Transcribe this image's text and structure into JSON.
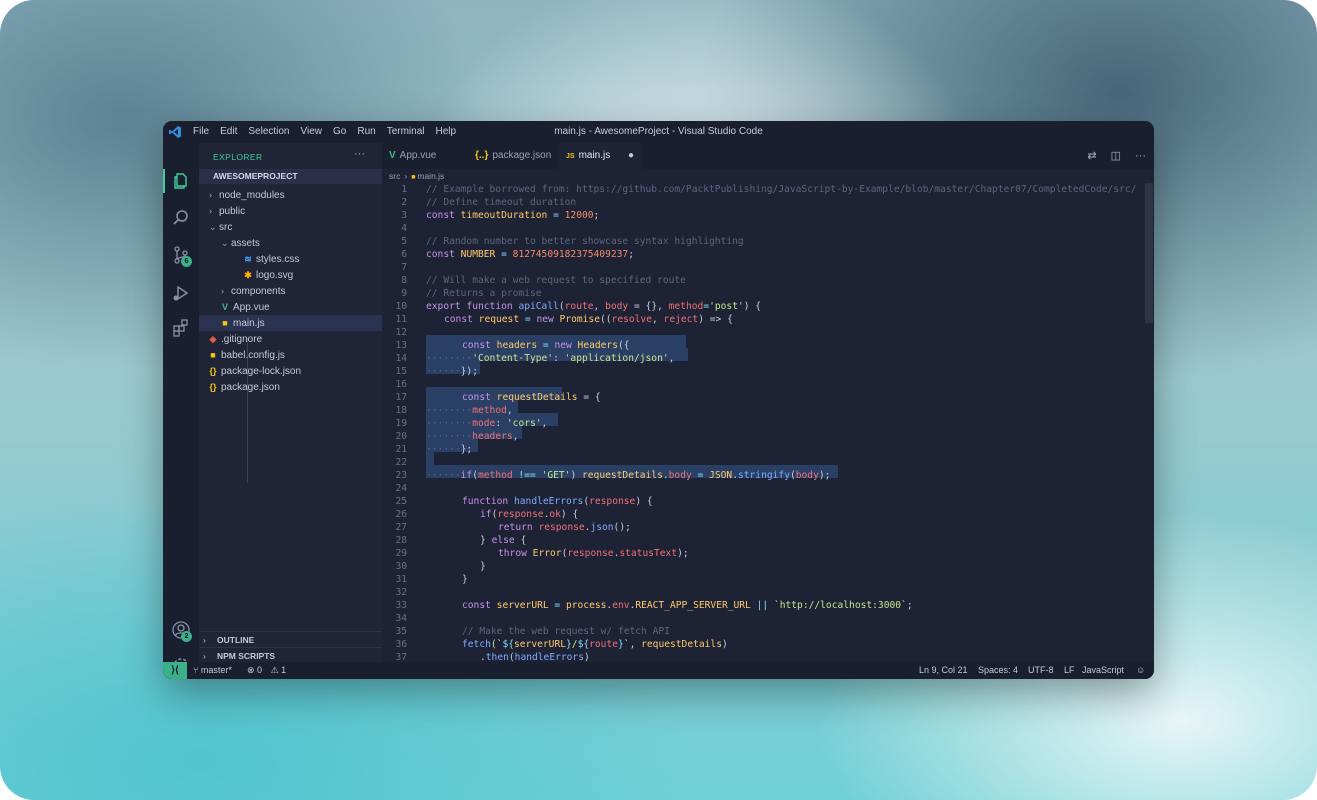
{
  "window": {
    "title": "main.js - AwesomeProject - Visual Studio Code",
    "menu": [
      "File",
      "Edit",
      "Selection",
      "View",
      "Go",
      "Run",
      "Terminal",
      "Help"
    ]
  },
  "activity": {
    "scm_badge": "6",
    "accounts_badge": "2"
  },
  "sidebar": {
    "header": "EXPLORER",
    "more": "···",
    "project": "AWESOMEPROJECT",
    "items": [
      {
        "label": "node_modules",
        "icon": "chevron-right"
      },
      {
        "label": "public",
        "icon": "chevron-right"
      },
      {
        "label": "src",
        "icon": "chevron-down"
      },
      {
        "label": "assets",
        "icon": "chevron-down"
      },
      {
        "label": "styles.css",
        "icon": "css-file-icon"
      },
      {
        "label": "logo.svg",
        "icon": "svg-file-icon"
      },
      {
        "label": "components",
        "icon": "chevron-right"
      },
      {
        "label": "App.vue",
        "icon": "vue-file-icon"
      },
      {
        "label": "main.js",
        "icon": "js-file-icon"
      },
      {
        "label": ".gitignore",
        "icon": "git-file-icon"
      },
      {
        "label": "babel.config.js",
        "icon": "js-file-icon"
      },
      {
        "label": "package-lock.json",
        "icon": "json-file-icon"
      },
      {
        "label": "package.json",
        "icon": "json-file-icon"
      }
    ],
    "outline": "OUTLINE",
    "npm_scripts": "NPM SCRIPTS"
  },
  "tabs": [
    {
      "label": "App.vue",
      "icon": "V"
    },
    {
      "label": "package.json",
      "icon": "{..}"
    },
    {
      "label": "main.js",
      "icon": "JS",
      "modified": "●"
    }
  ],
  "breadcrumb": [
    "src",
    "main.js"
  ],
  "code": {
    "lines": [
      {
        "n": "1"
      },
      {
        "n": "2"
      },
      {
        "n": "3"
      },
      {
        "n": "4"
      },
      {
        "n": "5"
      },
      {
        "n": "6"
      },
      {
        "n": "7"
      },
      {
        "n": "8"
      },
      {
        "n": "9"
      },
      {
        "n": "10"
      },
      {
        "n": "11"
      },
      {
        "n": "12"
      },
      {
        "n": "13"
      },
      {
        "n": "14"
      },
      {
        "n": "15"
      },
      {
        "n": "16"
      },
      {
        "n": "17"
      },
      {
        "n": "18"
      },
      {
        "n": "19"
      },
      {
        "n": "20"
      },
      {
        "n": "21"
      },
      {
        "n": "22"
      },
      {
        "n": "23"
      },
      {
        "n": "24"
      },
      {
        "n": "25"
      },
      {
        "n": "26"
      },
      {
        "n": "27"
      },
      {
        "n": "28"
      },
      {
        "n": "29"
      },
      {
        "n": "30"
      },
      {
        "n": "31"
      },
      {
        "n": "32"
      },
      {
        "n": "33"
      },
      {
        "n": "34"
      },
      {
        "n": "35"
      },
      {
        "n": "36"
      },
      {
        "n": "37"
      }
    ],
    "text": {
      "l1": "// Example borrowed from: https://github.com/PacktPublishing/JavaScript-by-Example/blob/master/Chapter07/CompletedCode/src/",
      "l2": "// Define timeout duration",
      "l3a": "const",
      "l3b": "timeoutDuration",
      "l3c": "=",
      "l3d": "12000",
      "l3e": ";",
      "l5": "// Random number to better showcase syntax highlighting",
      "l6a": "const",
      "l6b": "NUMBER",
      "l6c": "=",
      "l6d": "81274509182375409237",
      "l6e": ";",
      "l8": "// Will make a web request to specified route",
      "l9": "// Returns a promise",
      "l10a": "export",
      "l10b": "function",
      "l10c": "apiCall",
      "l10d": "(",
      "l10e": "route",
      "l10f": ", ",
      "l10g": "body",
      "l10h": " = {}, ",
      "l10i": "method",
      "l10j": "=",
      "l10k": "'post'",
      "l10l": ") {",
      "l11a": "const",
      "l11b": "request",
      "l11c": " = ",
      "l11d": "new",
      "l11e": "Promise",
      "l11f": "((",
      "l11g": "resolve",
      "l11h": ", ",
      "l11i": "reject",
      "l11j": ") => {",
      "l13a": "const",
      "l13b": "headers",
      "l13c": " = ",
      "l13d": "new",
      "l13e": "Headers",
      "l13f": "({",
      "l14a": "'Content-Type'",
      "l14b": ": ",
      "l14c": "'application/json'",
      "l14d": ",",
      "l15": "});",
      "l17a": "const",
      "l17b": "requestDetails",
      "l17c": " = {",
      "l18a": "method",
      "l18b": ",",
      "l19a": "mode",
      "l19b": ": ",
      "l19c": "'cors'",
      "l19d": ",",
      "l20a": "headers",
      "l20b": ",",
      "l21": "};",
      "l23a": "if",
      "l23b": "(",
      "l23c": "method",
      "l23d": " !== ",
      "l23e": "'GET'",
      "l23f": ") ",
      "l23g": "requestDetails",
      "l23h": ".",
      "l23i": "body",
      "l23j": " = ",
      "l23k": "JSON",
      "l23l": ".",
      "l23m": "stringify",
      "l23n": "(",
      "l23o": "body",
      "l23p": ");",
      "l25a": "function",
      "l25b": "handleErrors",
      "l25c": "(",
      "l25d": "response",
      "l25e": ") {",
      "l26a": "if",
      "l26b": "(",
      "l26c": "response",
      "l26d": ".",
      "l26e": "ok",
      "l26f": ") {",
      "l27a": "return",
      "l27b": "response",
      "l27c": ".",
      "l27d": "json",
      "l27e": "();",
      "l28a": "} ",
      "l28b": "else",
      "l28c": " {",
      "l29a": "throw",
      "l29b": "Error",
      "l29c": "(",
      "l29d": "response",
      "l29e": ".",
      "l29f": "statusText",
      "l29g": ");",
      "l30": "}",
      "l31": "}",
      "l33a": "const",
      "l33b": "serverURL",
      "l33c": " = ",
      "l33d": "process",
      "l33e": ".",
      "l33f": "env",
      "l33g": ".",
      "l33h": "REACT_APP_SERVER_URL",
      "l33i": " || ",
      "l33j": "`http://localhost:3000`",
      "l33k": ";",
      "l35": "// Make the web request w/ fetch API",
      "l36a": "fetch",
      "l36b": "(`",
      "l36c": "${",
      "l36d": "serverURL",
      "l36e": "}",
      "l36f": "/",
      "l36g": "${",
      "l36h": "route",
      "l36i": "}",
      "l36j": "`, ",
      "l36k": "requestDetails",
      "l36l": ")",
      "l37a": ".",
      "l37b": "then",
      "l37c": "(",
      "l37d": "handleErrors",
      "l37e": ")",
      "dots4": "······",
      "dots6": "········"
    }
  },
  "status": {
    "branch": "master*",
    "errors": "0",
    "warnings": "1",
    "position": "Ln 9, Col 21",
    "spaces": "Spaces: 4",
    "encoding": "UTF-8",
    "eol": "LF",
    "language": "JavaScript"
  },
  "colors": {
    "accent": "#3fcf9a",
    "remote": "#3bb08b",
    "selection": "#2e4a73"
  }
}
